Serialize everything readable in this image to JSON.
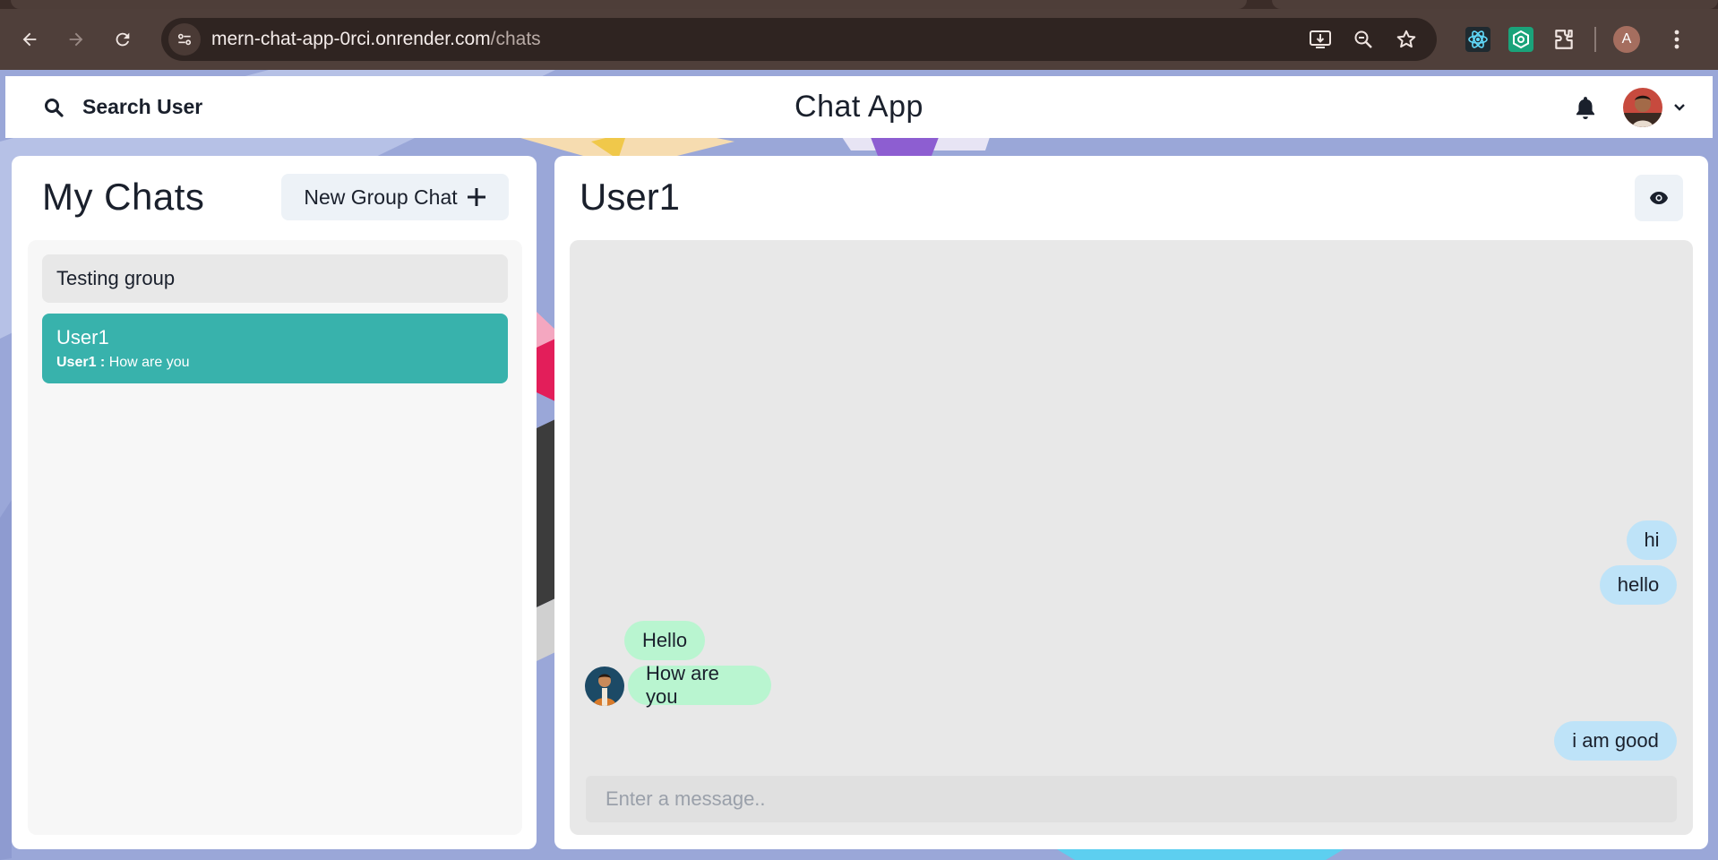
{
  "browser": {
    "url_host": "mern-chat-app-0rci.onrender.com",
    "url_path": "/chats",
    "profile_initial": "A"
  },
  "header": {
    "search_label": "Search User",
    "title": "Chat App"
  },
  "my_chats": {
    "title": "My Chats",
    "new_group_label": "New Group Chat",
    "items": [
      {
        "name": "Testing group"
      },
      {
        "name": "User1",
        "latest_sender": "User1 :",
        "latest_text": "How are you"
      }
    ]
  },
  "chat": {
    "title": "User1",
    "messages": [
      {
        "text": "hi",
        "side": "sent"
      },
      {
        "text": "hello",
        "side": "sent"
      },
      {
        "text": "Hello",
        "side": "received"
      },
      {
        "text": "How are you",
        "side": "received"
      },
      {
        "text": "i am good",
        "side": "sent"
      }
    ],
    "input_placeholder": "Enter a message.."
  },
  "colors": {
    "accent": "#38b2ac",
    "sent_bubble": "#bee3f8",
    "received_bubble": "#b9f5d0"
  }
}
